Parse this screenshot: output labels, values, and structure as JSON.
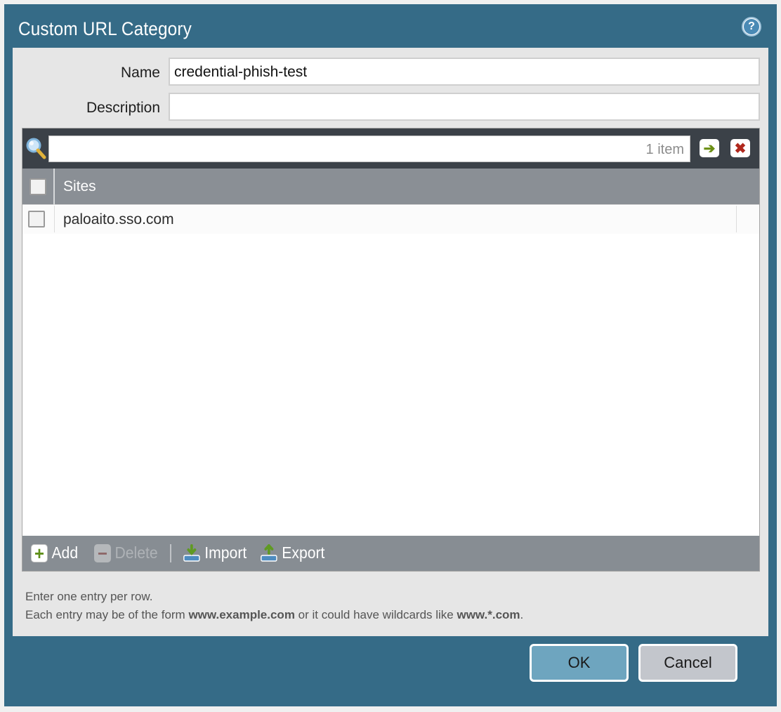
{
  "dialog": {
    "title": "Custom URL Category",
    "help_icon": "question-mark-icon"
  },
  "form": {
    "name_label": "Name",
    "name_value": "credential-phish-test",
    "description_label": "Description",
    "description_value": ""
  },
  "filter": {
    "search_icon": "magnifier-icon",
    "value": "",
    "count_text": "1 item",
    "apply_icon": "arrow-right-icon",
    "clear_icon": "close-x-icon"
  },
  "table": {
    "columns": [
      "Sites"
    ],
    "rows": [
      {
        "site": "paloaito.sso.com",
        "checked": false
      }
    ]
  },
  "actions": {
    "add": "Add",
    "delete": "Delete",
    "import": "Import",
    "export": "Export"
  },
  "hint": {
    "line1": "Enter one entry per row.",
    "line2_a": "Each entry may be of the form ",
    "line2_example1": "www.example.com",
    "line2_b": " or it could have wildcards like ",
    "line2_example2": "www.*.com",
    "line2_c": "."
  },
  "buttons": {
    "ok": "OK",
    "cancel": "Cancel"
  },
  "colors": {
    "dialog_frame": "#356b87",
    "panel": "#e6e6e6",
    "grid_header": "#8a8f95",
    "ok_button": "#6ea5bf",
    "cancel_button": "#c3c6cc"
  }
}
